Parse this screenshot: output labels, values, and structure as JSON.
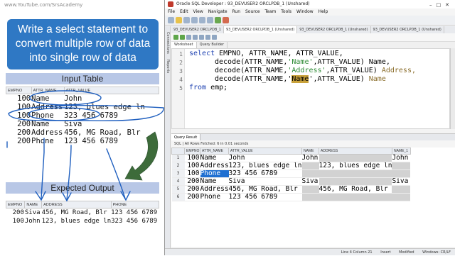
{
  "slide": {
    "watermark": "www.YouTube.com/SrsAcademy",
    "title_lines": [
      "Write a select statement to",
      "convert multiple row of data",
      "into single row of data"
    ],
    "input_label": "Input Table",
    "output_label": "Expected Output",
    "input_table": {
      "headers": [
        "EMPNO",
        "ATTR_NAME",
        "ATTR_VALUE"
      ],
      "rows": [
        [
          "100",
          "Name",
          "John"
        ],
        [
          "100",
          "Address",
          "123, blues edge ln"
        ],
        [
          "100",
          "Phone",
          "323 456 6789"
        ],
        [
          "200",
          "Name",
          "Siva"
        ],
        [
          "200",
          "Address",
          "456, MG Road, Blr"
        ],
        [
          "200",
          "Phone",
          "123 456 6789"
        ]
      ]
    },
    "output_table": {
      "headers": [
        "EMPNO",
        "NAME",
        "ADDRESS",
        "PHONE"
      ],
      "rows": [
        [
          "200",
          "Siva",
          "456, MG Road, Blr",
          "123 456 6789"
        ],
        [
          "100",
          "John",
          "123, blues edge ln",
          "323 456 6789"
        ]
      ]
    },
    "colors": {
      "title_bg": "#2f78c4",
      "band_bg": "#b8c7e6",
      "arrow": "#3d6b3a",
      "annotation": "#1f5fbf"
    }
  },
  "window": {
    "title": "Oracle SQL Developer : 93_DEVUSER2 ORCLPDB_1 (Unshared)",
    "menu": [
      "File",
      "Edit",
      "View",
      "Navigate",
      "Run",
      "Source",
      "Team",
      "Tools",
      "Window",
      "Help"
    ],
    "sidebar_labels": [
      "Connections",
      "Reports"
    ],
    "file_tabs": [
      "93_DEVUSER2 ORCLPDB_1",
      "93_DEVUSER2 ORCLPDB_1 (Unshared)",
      "93_DEVUSER2 ORCLPDB_1 (Unshared)",
      "93_DEVUSER2 ORCLPDB_1 (Unshared)"
    ],
    "editor_subtabs": [
      "Worksheet",
      "Query Builder"
    ],
    "code": {
      "l1_kw": "select",
      "l1_rest": " EMPNO, ATTR_NAME, ATTR_VALUE,",
      "l2_a": "decode(ATTR_NAME,",
      "l2_str": "'Name'",
      "l2_b": ",ATTR_VALUE)",
      "l2_col": " Name,",
      "l3_a": "decode(ATTR_NAME,",
      "l3_str": "'Address'",
      "l3_b": ",ATTR_VALUE)",
      "l3_col": " Address,",
      "l4_a": "decode(ATTR_NAME,'",
      "l4_hl": "Name",
      "l4_c": "',ATTR_VALUE)",
      "l4_col": " Name",
      "l5_kw": "from",
      "l5_rest": " emp;"
    },
    "result_tab": "Query Result",
    "result_toolbar": "SQL | All Rows Fetched: 6 in 0.01 seconds",
    "result_headers": [
      "EMPNO",
      "ATTR_NAME",
      "ATTR_VALUE",
      "NAME",
      "ADDRESS",
      "NAME_1"
    ],
    "result_rows": [
      [
        "1",
        "100",
        "Name",
        "John",
        "John",
        "",
        "John"
      ],
      [
        "2",
        "100",
        "Address",
        "123, blues edge ln",
        "",
        "123, blues edge ln",
        ""
      ],
      [
        "3",
        "100",
        "Phone",
        "323 456 6789",
        "",
        "",
        ""
      ],
      [
        "4",
        "200",
        "Name",
        "Siva",
        "Siva",
        "",
        "Siva"
      ],
      [
        "5",
        "200",
        "Address",
        "456, MG Road, Blr",
        "",
        "456, MG Road, Blr",
        ""
      ],
      [
        "6",
        "200",
        "Phone",
        "123 456 6789",
        "",
        "",
        ""
      ]
    ],
    "status": {
      "position": "Line 4 Column 21",
      "mode": "Insert",
      "modified": "Modified",
      "os": "Windows: CR/LF"
    }
  }
}
